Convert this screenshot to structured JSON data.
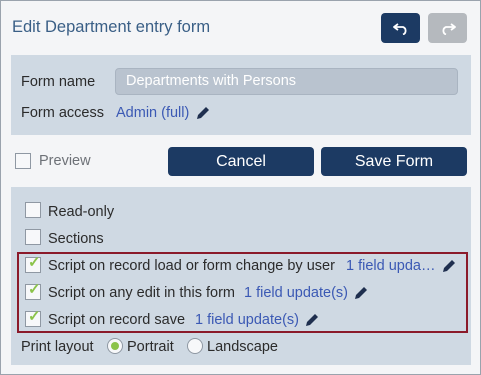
{
  "header": {
    "title": "Edit Department entry form",
    "undo_icon": "undo-icon",
    "redo_icon": "redo-icon"
  },
  "form": {
    "name_label": "Form name",
    "name_value": "Departments with Persons",
    "access_label": "Form access",
    "access_value": "Admin (full)"
  },
  "preview_label": "Preview",
  "actions": {
    "cancel_label": "Cancel",
    "save_label": "Save Form"
  },
  "options": {
    "read_only_label": "Read-only",
    "sections_label": "Sections",
    "scripts": [
      {
        "label": "Script on record load or form change by user",
        "link": "1 field upda…",
        "checked": true
      },
      {
        "label": "Script on any edit in this form",
        "link": "1 field update(s)",
        "checked": true
      },
      {
        "label": "Script on record save",
        "link": "1 field update(s)",
        "checked": true
      }
    ],
    "print_layout_label": "Print layout",
    "print_layout_options": [
      "Portrait",
      "Landscape"
    ],
    "print_layout_selected": "Portrait"
  },
  "colors": {
    "accent": "#1c3a63",
    "link": "#3b59b4",
    "check": "#8bc34a",
    "highlight_border": "#8b1a2a"
  }
}
